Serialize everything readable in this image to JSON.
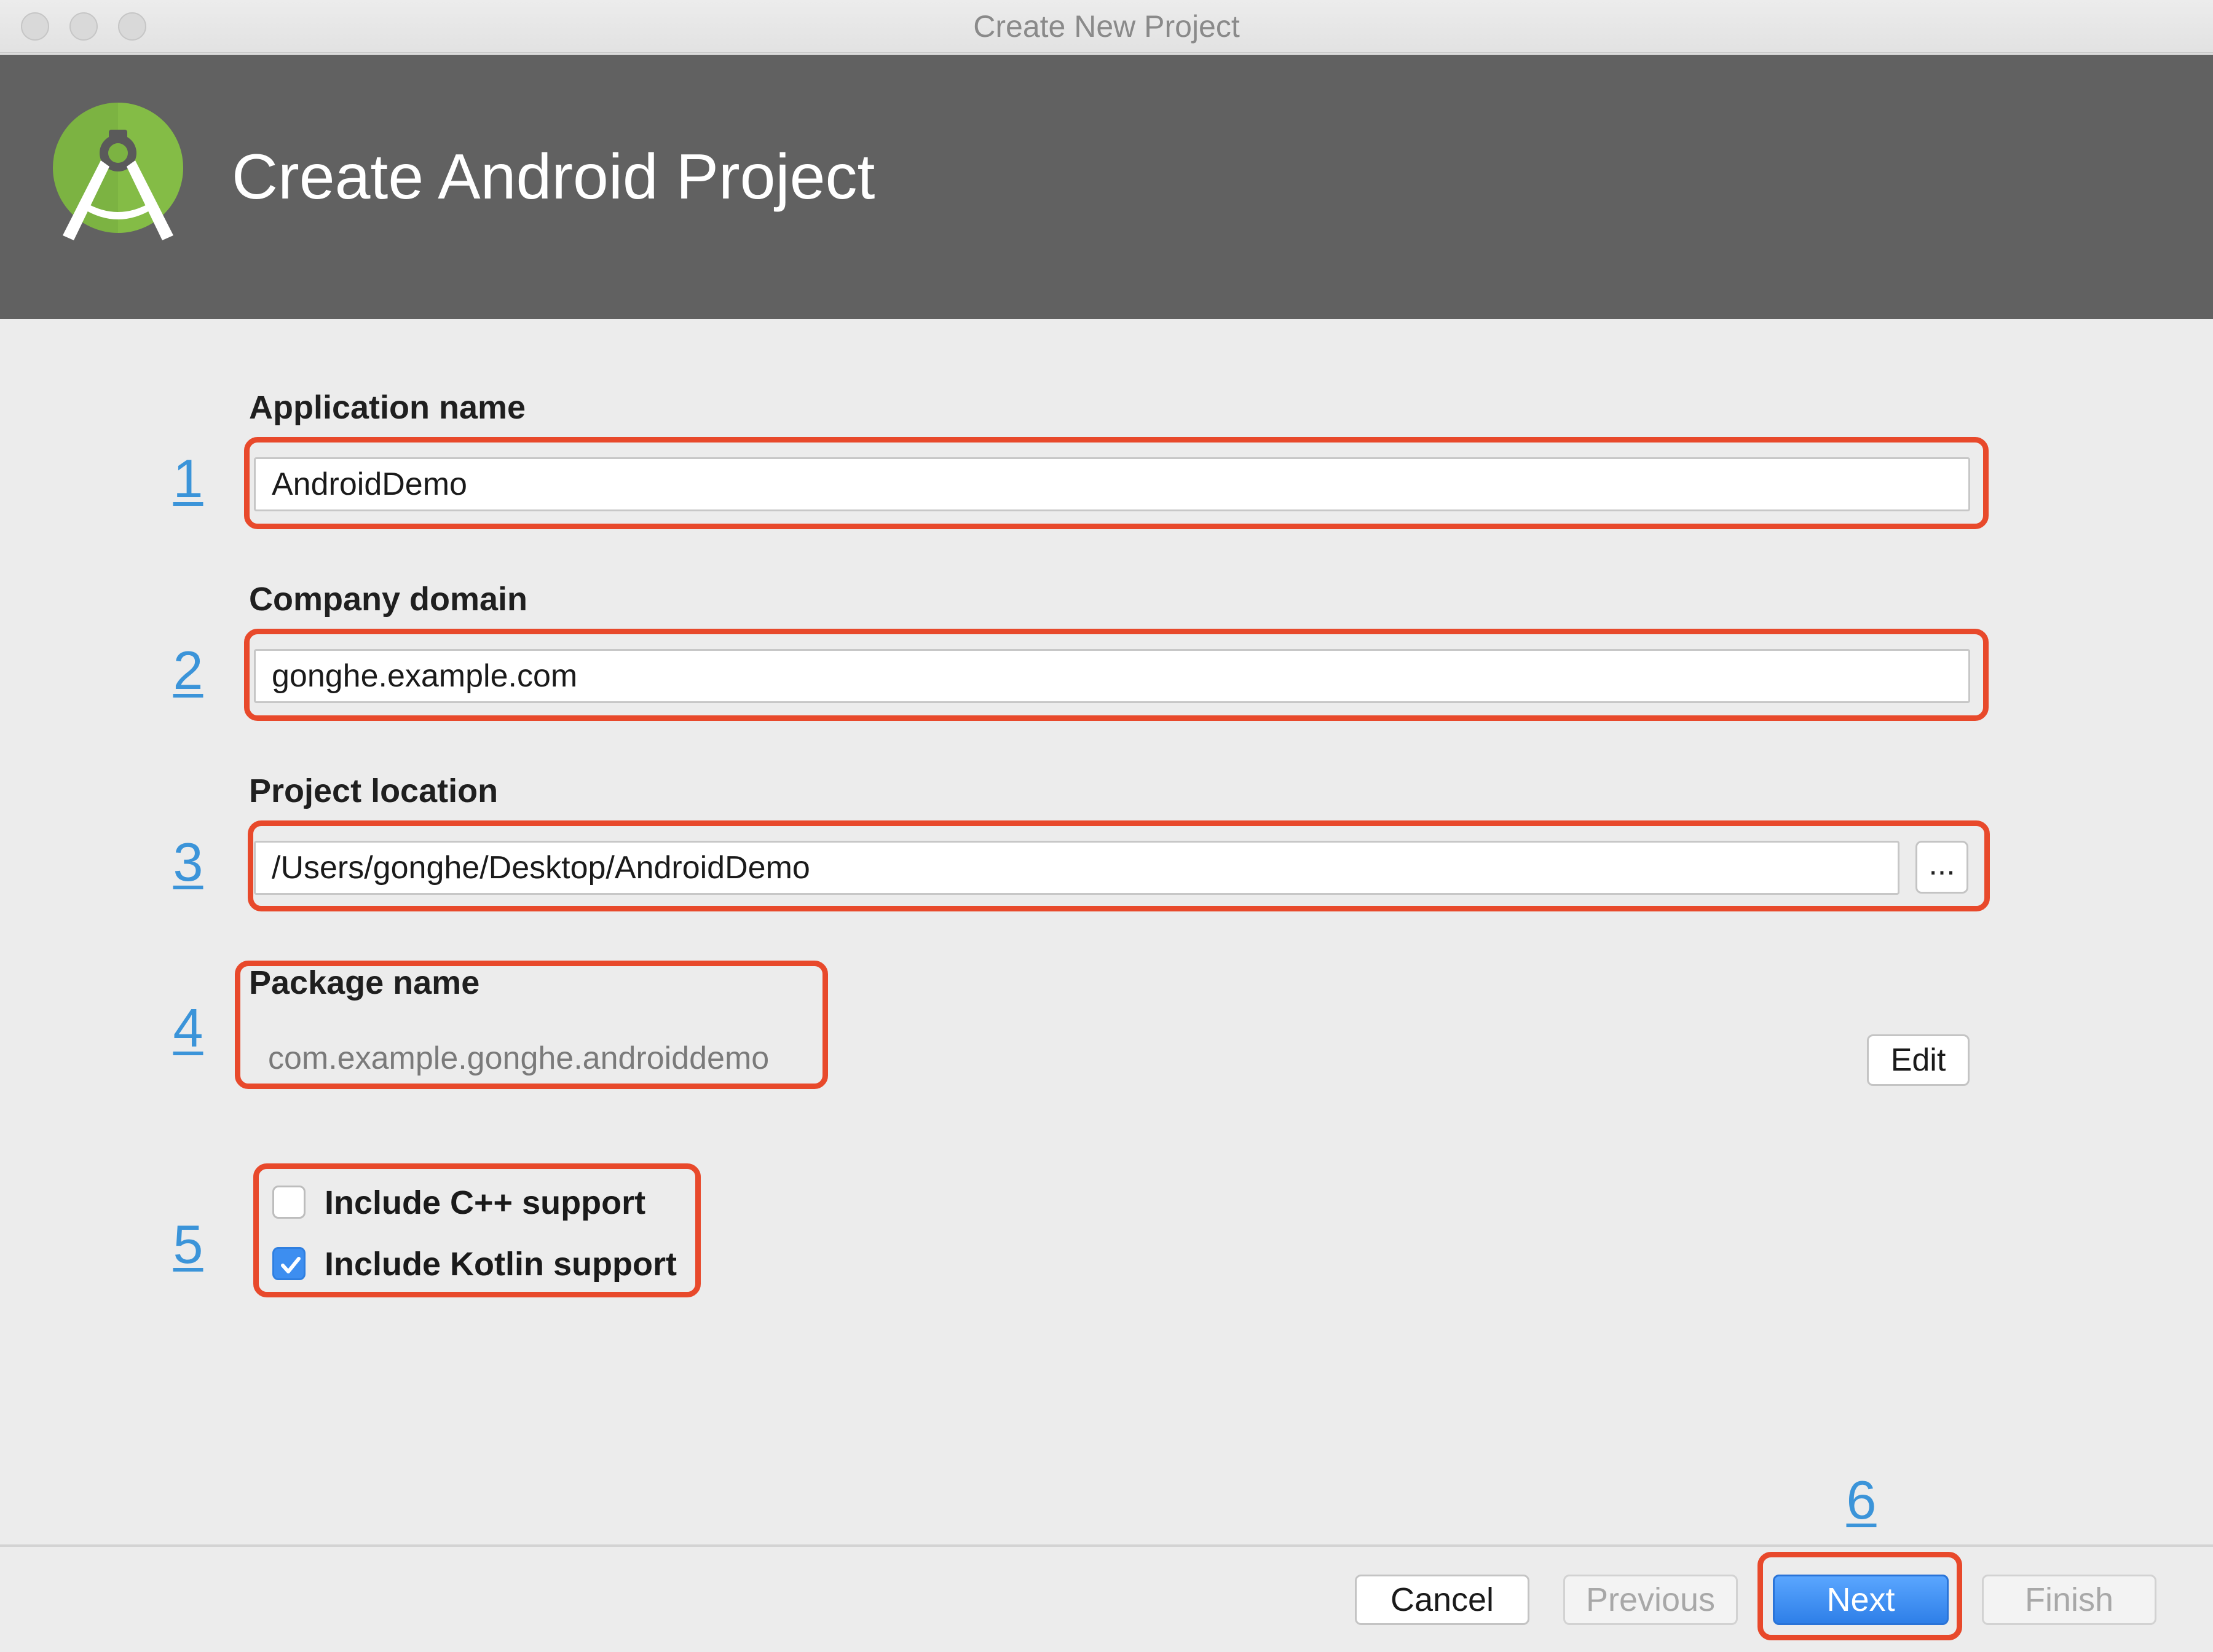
{
  "window": {
    "title": "Create New Project"
  },
  "header": {
    "title": "Create Android Project",
    "logo_icon": "android-studio-logo-icon"
  },
  "form": {
    "app_name": {
      "step": "1",
      "label": "Application name",
      "value": "AndroidDemo"
    },
    "company_domain": {
      "step": "2",
      "label": "Company domain",
      "value": "gonghe.example.com"
    },
    "project_location": {
      "step": "3",
      "label": "Project location",
      "value": "/Users/gonghe/Desktop/AndroidDemo",
      "browse_label": "..."
    },
    "package_name": {
      "step": "4",
      "label": "Package name",
      "value": "com.example.gonghe.androiddemo",
      "edit_label": "Edit"
    },
    "options": {
      "step": "5",
      "cpp_support": {
        "label": "Include C++ support",
        "checked": false
      },
      "kotlin_support": {
        "label": "Include Kotlin support",
        "checked": true
      }
    }
  },
  "footer": {
    "next_step": "6",
    "cancel_label": "Cancel",
    "previous_label": "Previous",
    "next_label": "Next",
    "finish_label": "Finish"
  },
  "colors": {
    "callout": "#e8492b",
    "step_number": "#3b94d9",
    "primary_button": "#2e7fe8",
    "header_bg": "#616161"
  }
}
